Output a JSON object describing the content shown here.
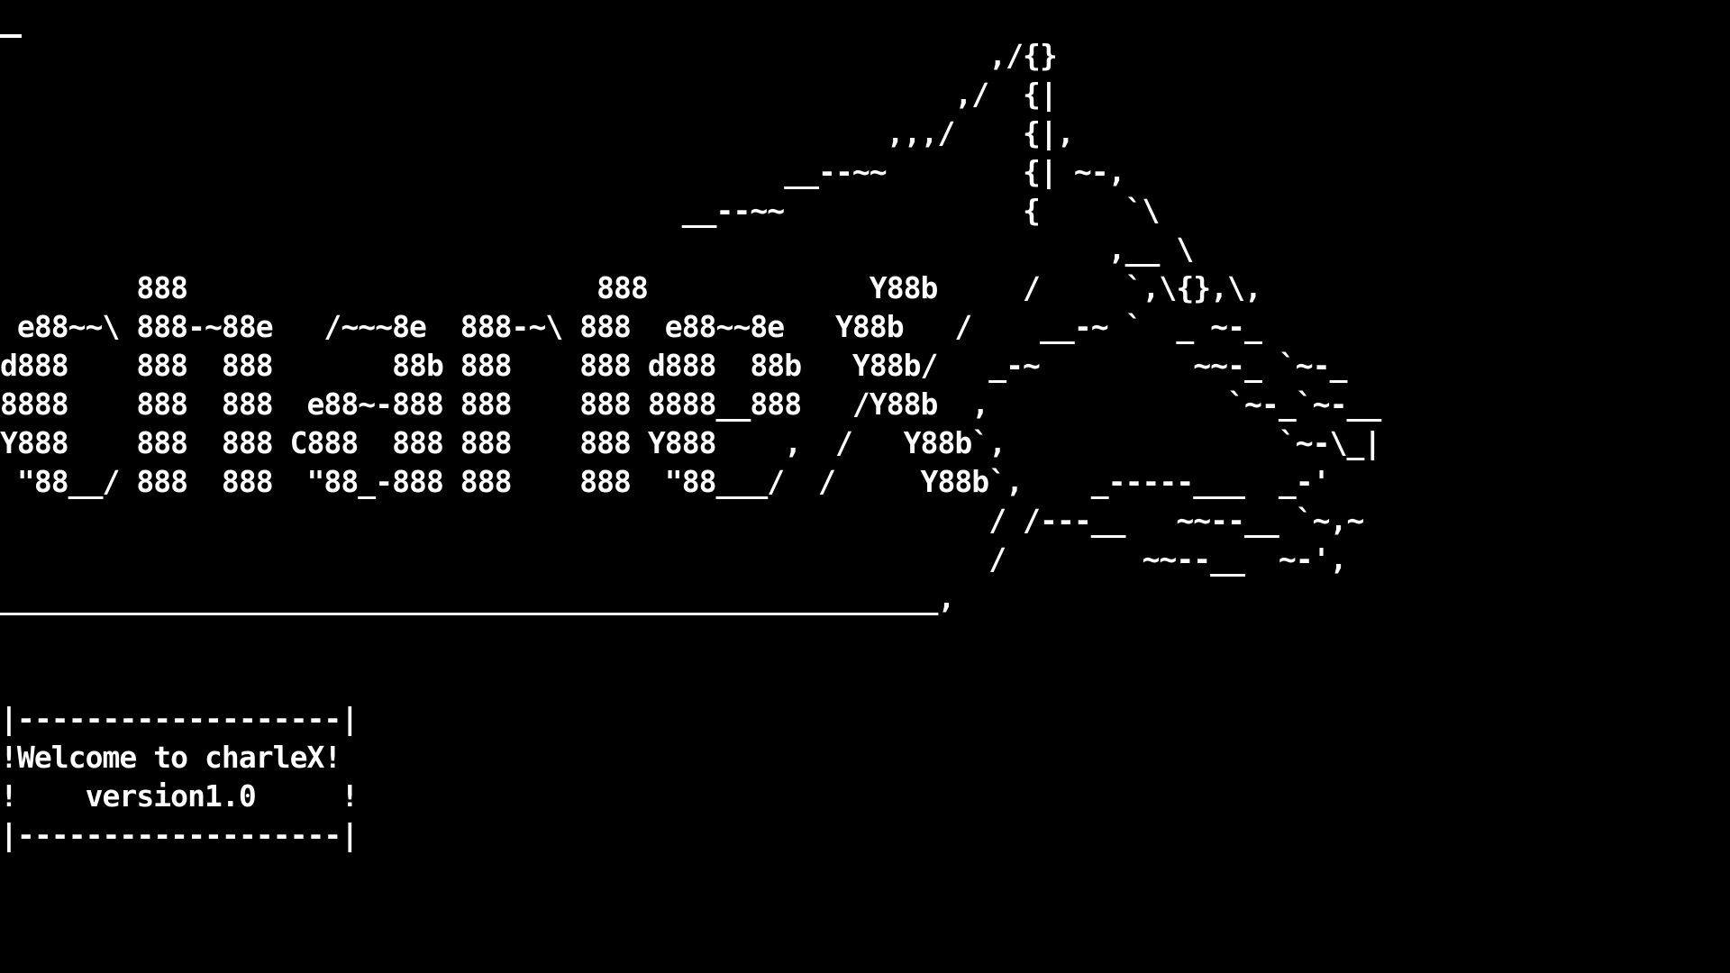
{
  "terminal": {
    "cursor_char": "_",
    "banner_ascii": "                                                          ,/{}\n                                                        ,/  {|\n                                                    ,,,/    {|,\n                                              __--~~        {| ~-,\n                                        __--~~              {     `\\\n                                                                 ,__ \\\n        888                        888             Y88b     /     `,\\{},\\,\n e88~~\\ 888-~88e   /~~~8e  888-~\\ 888  e88~~8e   Y88b   /    __-~ `  _ ~-_\nd888    888  888       88b 888    888 d888  88b   Y88b/   _-~         ~~-_ `~-_\n8888    888  888  e88~-888 888    888 8888__888   /Y88b  ,              `~-_`~-__\nY888    888  888 C888  888 888    888 Y888    ,  /   Y88b`,                `~-\\_|\n \"88__/ 888  888  \"88_-888 888    888  \"88___/  /     Y88b`,    _-----___  _-'\n                                                          / /---__   ~~--__ `~,~\n                                                          /        ~~--__  ~-',\n_______________________________________________________,",
    "welcome_box": "|-------------------|\n!Welcome to charleX!\n!    version1.0     !\n|-------------------|"
  }
}
